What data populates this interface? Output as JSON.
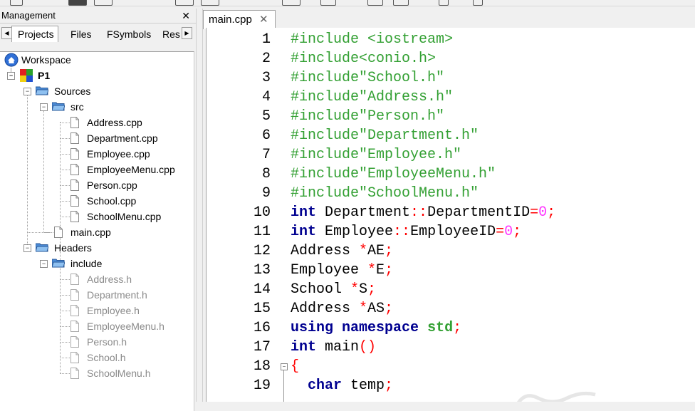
{
  "management": {
    "title": "Management",
    "close_label": "✕",
    "tabs": [
      {
        "label": "Projects",
        "active": true
      },
      {
        "label": "Files",
        "active": false
      },
      {
        "label": "FSymbols",
        "active": false
      },
      {
        "label": "Res",
        "active": false
      }
    ],
    "tree": {
      "workspace": "Workspace",
      "project": "P1",
      "sources": "Sources",
      "src": "src",
      "src_files": [
        "Address.cpp",
        "Department.cpp",
        "Employee.cpp",
        "EmployeeMenu.cpp",
        "Person.cpp",
        "School.cpp",
        "SchoolMenu.cpp"
      ],
      "main_file": "main.cpp",
      "headers": "Headers",
      "include": "include",
      "header_files": [
        "Address.h",
        "Department.h",
        "Employee.h",
        "EmployeeMenu.h",
        "Person.h",
        "School.h",
        "SchoolMenu.h"
      ]
    }
  },
  "editor": {
    "tab_label": "main.cpp",
    "tab_close": "✕",
    "line_numbers": [
      "1",
      "2",
      "3",
      "4",
      "5",
      "6",
      "7",
      "8",
      "9",
      "10",
      "11",
      "12",
      "13",
      "14",
      "15",
      "16",
      "17",
      "18",
      "19"
    ],
    "lines": [
      [
        {
          "t": "#include <iostream>",
          "c": "pre"
        }
      ],
      [
        {
          "t": "#include<conio.h>",
          "c": "pre"
        }
      ],
      [
        {
          "t": "#include\"School.h\"",
          "c": "pre"
        }
      ],
      [
        {
          "t": "#include\"Address.h\"",
          "c": "pre"
        }
      ],
      [
        {
          "t": "#include\"Person.h\"",
          "c": "pre"
        }
      ],
      [
        {
          "t": "#include\"Department.h\"",
          "c": "pre"
        }
      ],
      [
        {
          "t": "#include\"Employee.h\"",
          "c": "pre"
        }
      ],
      [
        {
          "t": "#include\"EmployeeMenu.h\"",
          "c": "pre"
        }
      ],
      [
        {
          "t": "#include\"SchoolMenu.h\"",
          "c": "pre"
        }
      ],
      [
        {
          "t": "int",
          "c": "kw"
        },
        {
          "t": " Department",
          "c": ""
        },
        {
          "t": "::",
          "c": "op"
        },
        {
          "t": "DepartmentID",
          "c": ""
        },
        {
          "t": "=",
          "c": "op"
        },
        {
          "t": "0",
          "c": "num"
        },
        {
          "t": ";",
          "c": "op"
        }
      ],
      [
        {
          "t": "int",
          "c": "kw"
        },
        {
          "t": " Employee",
          "c": ""
        },
        {
          "t": "::",
          "c": "op"
        },
        {
          "t": "EmployeeID",
          "c": ""
        },
        {
          "t": "=",
          "c": "op"
        },
        {
          "t": "0",
          "c": "num"
        },
        {
          "t": ";",
          "c": "op"
        }
      ],
      [
        {
          "t": "Address ",
          "c": ""
        },
        {
          "t": "*",
          "c": "op"
        },
        {
          "t": "AE",
          "c": ""
        },
        {
          "t": ";",
          "c": "op"
        }
      ],
      [
        {
          "t": "Employee ",
          "c": ""
        },
        {
          "t": "*",
          "c": "op"
        },
        {
          "t": "E",
          "c": ""
        },
        {
          "t": ";",
          "c": "op"
        }
      ],
      [
        {
          "t": "School ",
          "c": ""
        },
        {
          "t": "*",
          "c": "op"
        },
        {
          "t": "S",
          "c": ""
        },
        {
          "t": ";",
          "c": "op"
        }
      ],
      [
        {
          "t": "Address ",
          "c": ""
        },
        {
          "t": "*",
          "c": "op"
        },
        {
          "t": "AS",
          "c": ""
        },
        {
          "t": ";",
          "c": "op"
        }
      ],
      [
        {
          "t": "using",
          "c": "kw"
        },
        {
          "t": " ",
          "c": ""
        },
        {
          "t": "namespace",
          "c": "kw"
        },
        {
          "t": " ",
          "c": ""
        },
        {
          "t": "std",
          "c": "std"
        },
        {
          "t": ";",
          "c": "op"
        }
      ],
      [
        {
          "t": "int",
          "c": "kw"
        },
        {
          "t": " main",
          "c": ""
        },
        {
          "t": "()",
          "c": "op"
        }
      ],
      [
        {
          "t": "{",
          "c": "op"
        }
      ],
      [
        {
          "t": "  ",
          "c": ""
        },
        {
          "t": "char",
          "c": "kw"
        },
        {
          "t": " temp",
          "c": ""
        },
        {
          "t": ";",
          "c": "op"
        }
      ]
    ]
  },
  "watermark": {
    "text_ar": "مستقل",
    "text_en": "mostaql.com"
  },
  "colors": {
    "preprocessor": "#33a033",
    "keyword": "#000090",
    "operator": "#ff0000",
    "number": "#ff33ff"
  }
}
